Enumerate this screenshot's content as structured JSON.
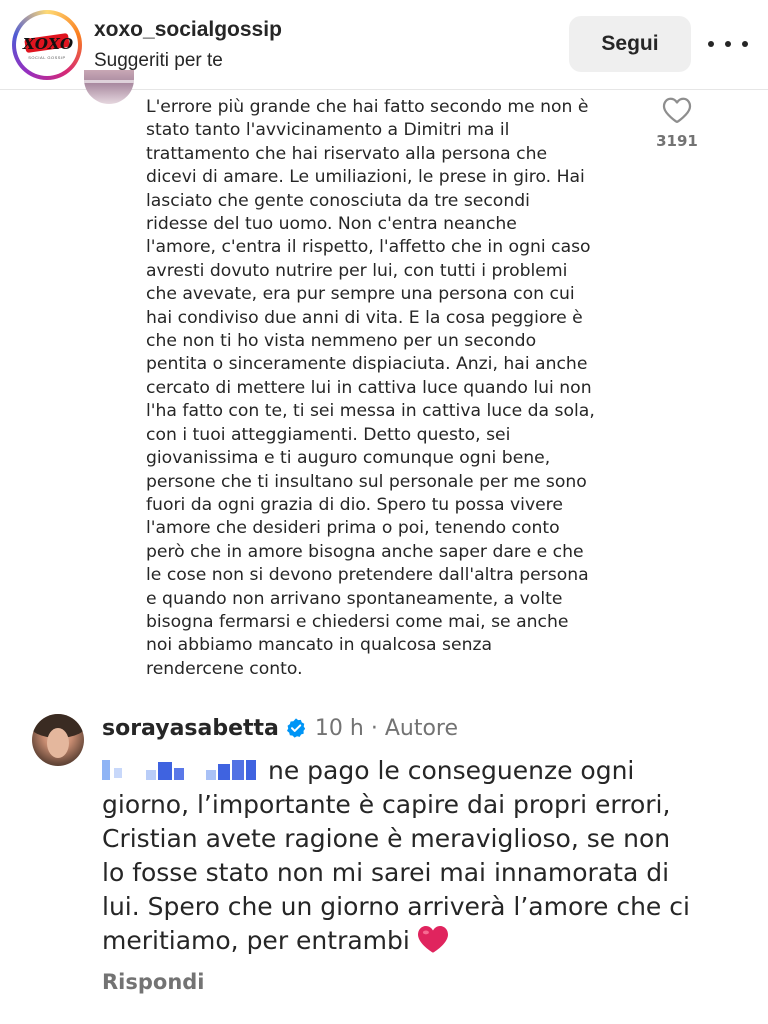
{
  "header": {
    "username": "xoxo_socialgossip",
    "subtitle": "Suggeriti per te",
    "follow_label": "Segui",
    "more_icon": "more-horizontal-icon",
    "logo_text": "XOXO",
    "logo_subtext": "SOCIAL GOSSIP"
  },
  "comment": {
    "lines": [
      "L'errore più grande che hai fatto secondo me non è",
      "stato tanto l'avvicinamento a Dimitri ma il",
      "trattamento che hai riservato alla persona che",
      "dicevi di amare. Le umiliazioni, le prese in giro. Hai",
      "lasciato che gente conosciuta da tre secondi",
      "ridesse del tuo uomo. Non c'entra neanche",
      "l'amore, c'entra il rispetto, l'affetto che in ogni caso",
      "avresti dovuto nutrire per lui, con tutti i problemi",
      "che avevate, era pur sempre una persona con cui",
      "hai condiviso due anni di vita. E la cosa peggiore è",
      "che non ti ho vista nemmeno per un secondo",
      "pentita o sinceramente dispiaciuta. Anzi, hai anche",
      "cercato di mettere lui in cattiva luce quando lui non",
      "l'ha fatto con te, ti sei messa in cattiva luce da sola,",
      "con i tuoi atteggiamenti. Detto questo, sei",
      "giovanissima e ti auguro comunque ogni bene,",
      "persone che ti insultano sul personale per me sono",
      "fuori da ogni grazia di dio. Spero tu possa vivere",
      "l'amore che desideri prima o poi, tenendo conto",
      "però che in amore bisogna anche saper dare e che",
      "le cose non si devono pretendere dall'altra persona",
      "e quando non arrivano spontaneamente, a volte",
      "bisogna fermarsi e chiedersi come mai, se anche",
      "noi abbiamo mancato in qualcosa senza",
      "rendercene conto."
    ],
    "like_count": "3191",
    "like_icon": "heart-outline-icon"
  },
  "reply": {
    "username": "sorayasabetta",
    "verified_icon": "verified-badge-icon",
    "time": "10 h",
    "separator": "·",
    "author_label": "Autore",
    "lines": [
      "ne pago le conseguenze ogni",
      "giorno, l’importante è capire dai propri errori,",
      "Cristian avete ragione è meraviglioso, se non",
      "lo fosse stato non mi sarei mai innamorata di",
      "lui. Spero che un giorno arriverà l’amore che ci",
      "meritiamo, per entrambi"
    ],
    "emoji": "red-heart-emoji",
    "reply_label": "Rispondi"
  },
  "colors": {
    "text": "#262626",
    "secondary": "#737373",
    "button_bg": "#efefef",
    "verified": "#0095f6",
    "heart_red": "#e0245e",
    "mask_blue": "#3f63e0"
  }
}
